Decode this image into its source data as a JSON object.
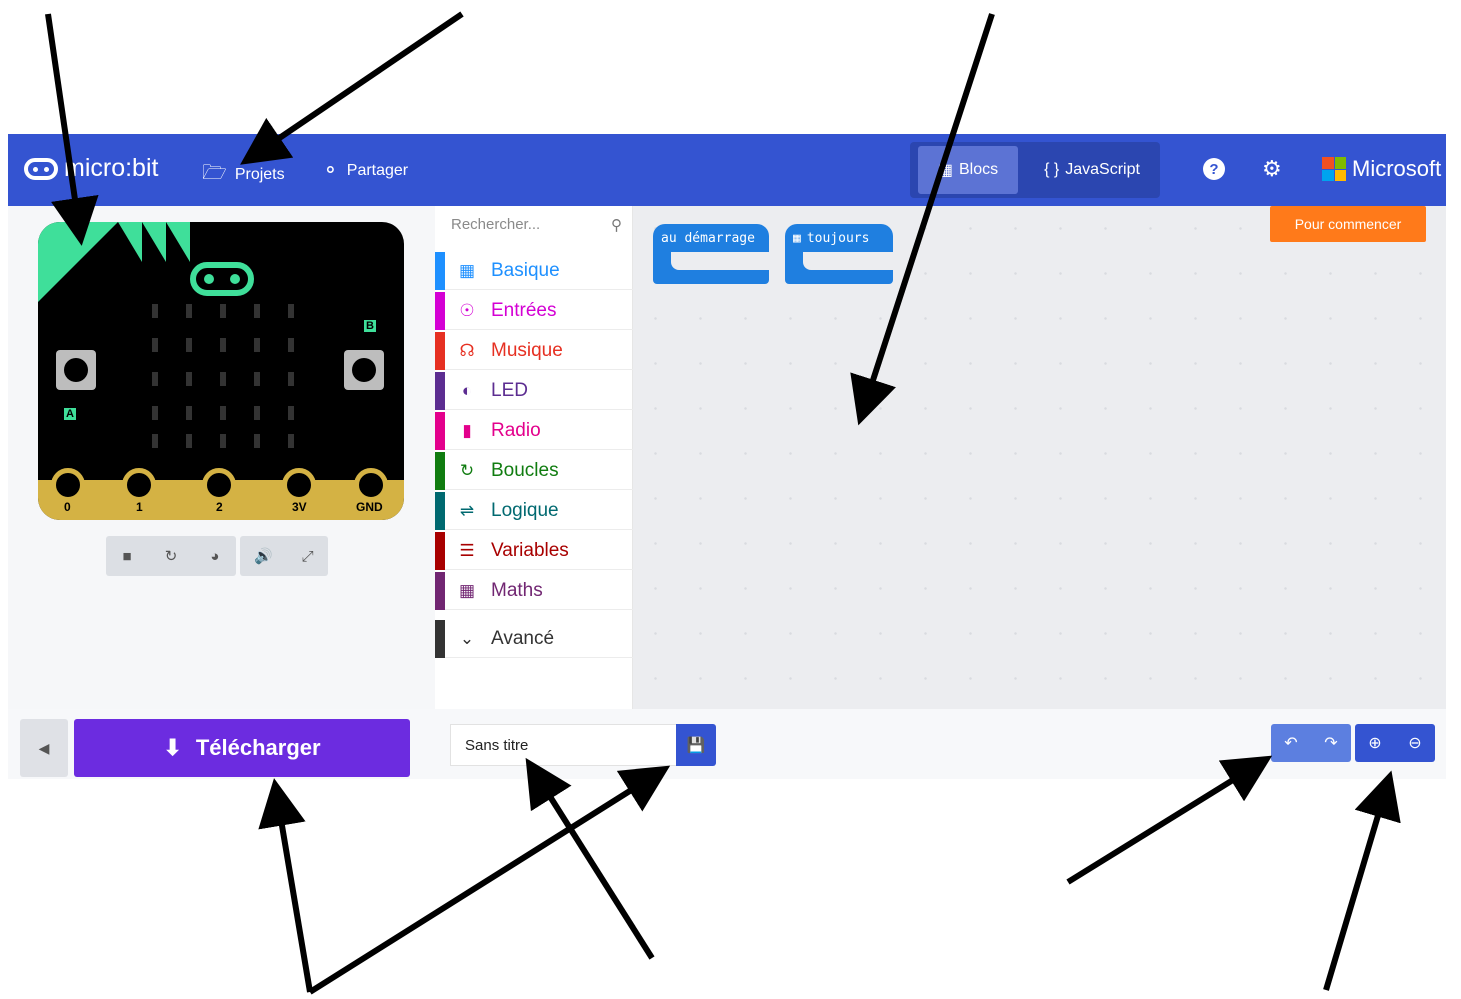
{
  "header": {
    "logo_text": "micro:bit",
    "projects_label": "Projets",
    "share_label": "Partager",
    "blocks_label": "Blocs",
    "javascript_label": "JavaScript",
    "microsoft_label": "Microsoft",
    "colors": {
      "bar": "#3454d1"
    }
  },
  "simulator": {
    "pins": [
      "0",
      "1",
      "2",
      "3V",
      "GND"
    ],
    "button_a": "A",
    "button_b": "B",
    "tools": [
      "stop-icon",
      "restart-icon",
      "slowmo-icon",
      "mute-icon",
      "fullscreen-icon"
    ]
  },
  "toolbox": {
    "search_placeholder": "Rechercher...",
    "categories": [
      {
        "label": "Basique",
        "color": "#1e90ff",
        "icon": "grid-icon"
      },
      {
        "label": "Entrées",
        "color": "#d400d4",
        "icon": "target-icon"
      },
      {
        "label": "Musique",
        "color": "#e63022",
        "icon": "headphones-icon"
      },
      {
        "label": "LED",
        "color": "#5c2d91",
        "icon": "toggle-icon"
      },
      {
        "label": "Radio",
        "color": "#e3008c",
        "icon": "signal-icon"
      },
      {
        "label": "Boucles",
        "color": "#107c10",
        "icon": "loop-icon"
      },
      {
        "label": "Logique",
        "color": "#006970",
        "icon": "shuffle-icon"
      },
      {
        "label": "Variables",
        "color": "#a80000",
        "icon": "list-icon"
      },
      {
        "label": "Maths",
        "color": "#712672",
        "icon": "calculator-icon"
      }
    ],
    "advanced_label": "Avancé"
  },
  "workspace": {
    "block_start": "au démarrage",
    "block_forever": "toujours",
    "getting_started": "Pour commencer"
  },
  "footer": {
    "download_label": "Télécharger",
    "project_name": "Sans titre"
  }
}
